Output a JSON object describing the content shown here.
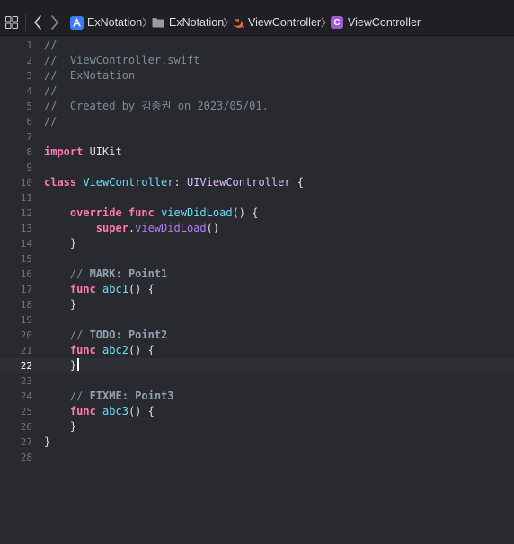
{
  "jumpbar": {
    "project": "ExNotation",
    "group": "ExNotation",
    "file": "ViewController",
    "symbol": "ViewController",
    "symbol_badge": "C"
  },
  "colors": {
    "background": "#292a30",
    "keyword": "#ff7ab2",
    "comment": "#7f8c98",
    "type": "#dabaff",
    "declaration": "#6bdfff",
    "method": "#b281eb",
    "plain": "#dfdfe0",
    "swift_icon": "#f0643c",
    "class_badge": "#a05bd3",
    "project_icon": "#3b7bf6"
  },
  "editor": {
    "current_line": 22,
    "lines": [
      {
        "n": "1",
        "tokens": [
          {
            "t": "//",
            "c": "comment"
          }
        ]
      },
      {
        "n": "2",
        "tokens": [
          {
            "t": "//  ViewController.swift",
            "c": "comment"
          }
        ]
      },
      {
        "n": "3",
        "tokens": [
          {
            "t": "//  ExNotation",
            "c": "comment"
          }
        ]
      },
      {
        "n": "4",
        "tokens": [
          {
            "t": "//",
            "c": "comment"
          }
        ]
      },
      {
        "n": "5",
        "tokens": [
          {
            "t": "//  Created by 김종권 on 2023/05/01.",
            "c": "comment"
          }
        ]
      },
      {
        "n": "6",
        "tokens": [
          {
            "t": "//",
            "c": "comment"
          }
        ]
      },
      {
        "n": "7",
        "tokens": []
      },
      {
        "n": "8",
        "tokens": [
          {
            "t": "import",
            "c": "kw"
          },
          {
            "t": " UIKit",
            "c": "plain"
          }
        ]
      },
      {
        "n": "9",
        "tokens": []
      },
      {
        "n": "10",
        "tokens": [
          {
            "t": "class",
            "c": "kw"
          },
          {
            "t": " ",
            "c": "plain"
          },
          {
            "t": "ViewController",
            "c": "def"
          },
          {
            "t": ": ",
            "c": "plain"
          },
          {
            "t": "UIViewController",
            "c": "type"
          },
          {
            "t": " {",
            "c": "plain"
          }
        ]
      },
      {
        "n": "11",
        "tokens": []
      },
      {
        "n": "12",
        "tokens": [
          {
            "t": "    ",
            "c": "plain"
          },
          {
            "t": "override",
            "c": "kw"
          },
          {
            "t": " ",
            "c": "plain"
          },
          {
            "t": "func",
            "c": "kw"
          },
          {
            "t": " ",
            "c": "plain"
          },
          {
            "t": "viewDidLoad",
            "c": "def"
          },
          {
            "t": "() {",
            "c": "plain"
          }
        ]
      },
      {
        "n": "13",
        "tokens": [
          {
            "t": "        ",
            "c": "plain"
          },
          {
            "t": "super",
            "c": "kw"
          },
          {
            "t": ".",
            "c": "plain"
          },
          {
            "t": "viewDidLoad",
            "c": "method"
          },
          {
            "t": "()",
            "c": "plain"
          }
        ]
      },
      {
        "n": "14",
        "tokens": [
          {
            "t": "    }",
            "c": "plain"
          }
        ]
      },
      {
        "n": "15",
        "tokens": []
      },
      {
        "n": "16",
        "tokens": [
          {
            "t": "    // ",
            "c": "comment"
          },
          {
            "t": "MARK:",
            "c": "mark"
          },
          {
            "t": " ",
            "c": "comment"
          },
          {
            "t": "Point1",
            "c": "mark"
          }
        ]
      },
      {
        "n": "17",
        "tokens": [
          {
            "t": "    ",
            "c": "plain"
          },
          {
            "t": "func",
            "c": "kw"
          },
          {
            "t": " ",
            "c": "plain"
          },
          {
            "t": "abc1",
            "c": "def"
          },
          {
            "t": "() {",
            "c": "plain"
          }
        ]
      },
      {
        "n": "18",
        "tokens": [
          {
            "t": "    }",
            "c": "plain"
          }
        ]
      },
      {
        "n": "19",
        "tokens": []
      },
      {
        "n": "20",
        "tokens": [
          {
            "t": "    // ",
            "c": "comment"
          },
          {
            "t": "TODO:",
            "c": "mark"
          },
          {
            "t": " ",
            "c": "comment"
          },
          {
            "t": "Point2",
            "c": "mark"
          }
        ]
      },
      {
        "n": "21",
        "tokens": [
          {
            "t": "    ",
            "c": "plain"
          },
          {
            "t": "func",
            "c": "kw"
          },
          {
            "t": " ",
            "c": "plain"
          },
          {
            "t": "abc2",
            "c": "def"
          },
          {
            "t": "() {",
            "c": "plain"
          }
        ]
      },
      {
        "n": "22",
        "tokens": [
          {
            "t": "    }",
            "c": "plain"
          }
        ],
        "caret": true
      },
      {
        "n": "23",
        "tokens": []
      },
      {
        "n": "24",
        "tokens": [
          {
            "t": "    // ",
            "c": "comment"
          },
          {
            "t": "FIXME:",
            "c": "mark"
          },
          {
            "t": " ",
            "c": "comment"
          },
          {
            "t": "Point3",
            "c": "mark"
          }
        ]
      },
      {
        "n": "25",
        "tokens": [
          {
            "t": "    ",
            "c": "plain"
          },
          {
            "t": "func",
            "c": "kw"
          },
          {
            "t": " ",
            "c": "plain"
          },
          {
            "t": "abc3",
            "c": "def"
          },
          {
            "t": "() {",
            "c": "plain"
          }
        ]
      },
      {
        "n": "26",
        "tokens": [
          {
            "t": "    }",
            "c": "plain"
          }
        ]
      },
      {
        "n": "27",
        "tokens": [
          {
            "t": "}",
            "c": "plain"
          }
        ]
      },
      {
        "n": "28",
        "tokens": []
      }
    ]
  }
}
